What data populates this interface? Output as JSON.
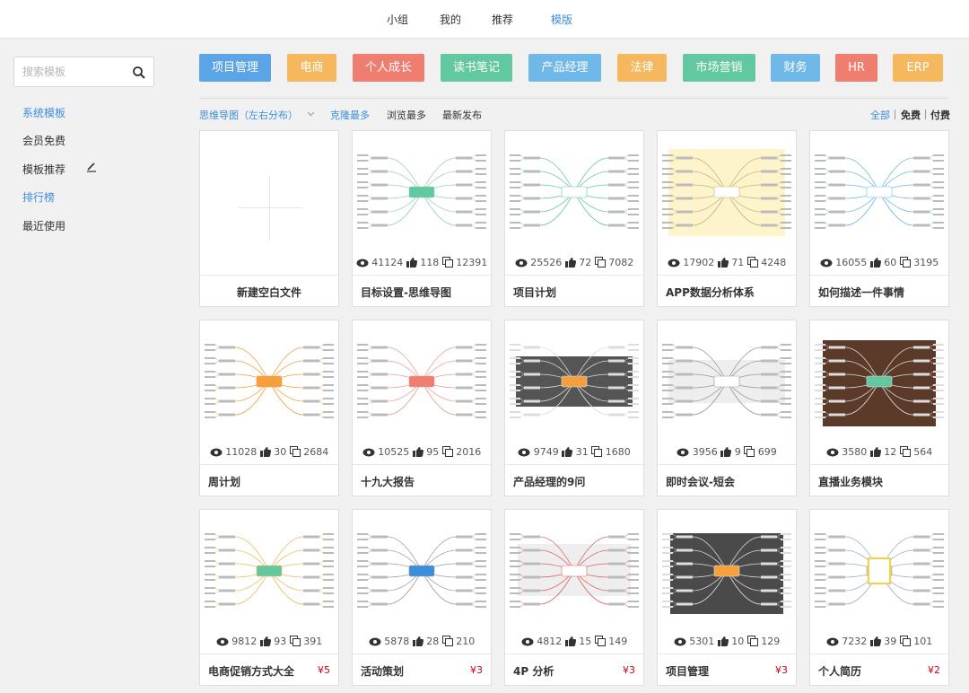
{
  "topnav": {
    "items": [
      {
        "label": "小组"
      },
      {
        "label": "我的"
      },
      {
        "label": "推荐"
      },
      {
        "label": "模版"
      }
    ]
  },
  "sidebar": {
    "search_placeholder": "搜索模板",
    "items": [
      {
        "label": "系统模板"
      },
      {
        "label": "会员免费"
      },
      {
        "label": "模板推荐"
      },
      {
        "label": "排行榜"
      },
      {
        "label": "最近使用"
      }
    ]
  },
  "categories": [
    {
      "label": "项目管理",
      "color": "#5ba4e6"
    },
    {
      "label": "电商",
      "color": "#f5b85f"
    },
    {
      "label": "个人成长",
      "color": "#ef7d70"
    },
    {
      "label": "读书笔记",
      "color": "#62c8a0"
    },
    {
      "label": "产品经理",
      "color": "#6fb8e8"
    },
    {
      "label": "法律",
      "color": "#f5b85f"
    },
    {
      "label": "市场营销",
      "color": "#62c8a0"
    },
    {
      "label": "财务",
      "color": "#6fb8e8"
    },
    {
      "label": "HR",
      "color": "#ef7d70"
    },
    {
      "label": "ERP",
      "color": "#f5b85f"
    }
  ],
  "filters": {
    "type_select": "思维导图（左右分布）",
    "sorts": [
      "克隆最多",
      "浏览最多",
      "最新发布"
    ],
    "pricing": [
      "全部",
      "免费",
      "付费"
    ]
  },
  "blank_card": {
    "title": "新建空白文件"
  },
  "cards": [
    {
      "title": "目标设置-思维导图",
      "views": "41124",
      "likes": "118",
      "clones": "12391",
      "price": "",
      "thumb": "green-tree"
    },
    {
      "title": "项目计划",
      "views": "25526",
      "likes": "72",
      "clones": "7082",
      "price": "",
      "thumb": "white-tree"
    },
    {
      "title": "APP数据分析体系",
      "views": "17902",
      "likes": "71",
      "clones": "4248",
      "price": "",
      "thumb": "yellow-bg"
    },
    {
      "title": "如何描述一件事情",
      "views": "16055",
      "likes": "60",
      "clones": "3195",
      "price": "",
      "thumb": "light-tree"
    },
    {
      "title": "周计划",
      "views": "11028",
      "likes": "30",
      "clones": "2684",
      "price": "",
      "thumb": "orange-node"
    },
    {
      "title": "十九大报告",
      "views": "10525",
      "likes": "95",
      "clones": "2016",
      "price": "",
      "thumb": "red-tree"
    },
    {
      "title": "产品经理的9问",
      "views": "9749",
      "likes": "31",
      "clones": "1680",
      "price": "",
      "thumb": "dark-bg"
    },
    {
      "title": "即时会议-短会",
      "views": "3956",
      "likes": "9",
      "clones": "699",
      "price": "",
      "thumb": "gray-bg"
    },
    {
      "title": "直播业务模块",
      "views": "3580",
      "likes": "12",
      "clones": "564",
      "price": "",
      "thumb": "brown-bg"
    },
    {
      "title": "电商促销方式大全",
      "views": "9812",
      "likes": "93",
      "clones": "391",
      "price": "¥5",
      "thumb": "rainbow"
    },
    {
      "title": "活动策划",
      "views": "5878",
      "likes": "28",
      "clones": "210",
      "price": "¥3",
      "thumb": "blue-node"
    },
    {
      "title": "4P 分析",
      "views": "4812",
      "likes": "15",
      "clones": "149",
      "price": "¥3",
      "thumb": "gray-4p"
    },
    {
      "title": "项目管理",
      "views": "5301",
      "likes": "10",
      "clones": "129",
      "price": "¥3",
      "thumb": "dark-orange"
    },
    {
      "title": "个人简历",
      "views": "7232",
      "likes": "39",
      "clones": "101",
      "price": "¥2",
      "thumb": "resume"
    }
  ]
}
